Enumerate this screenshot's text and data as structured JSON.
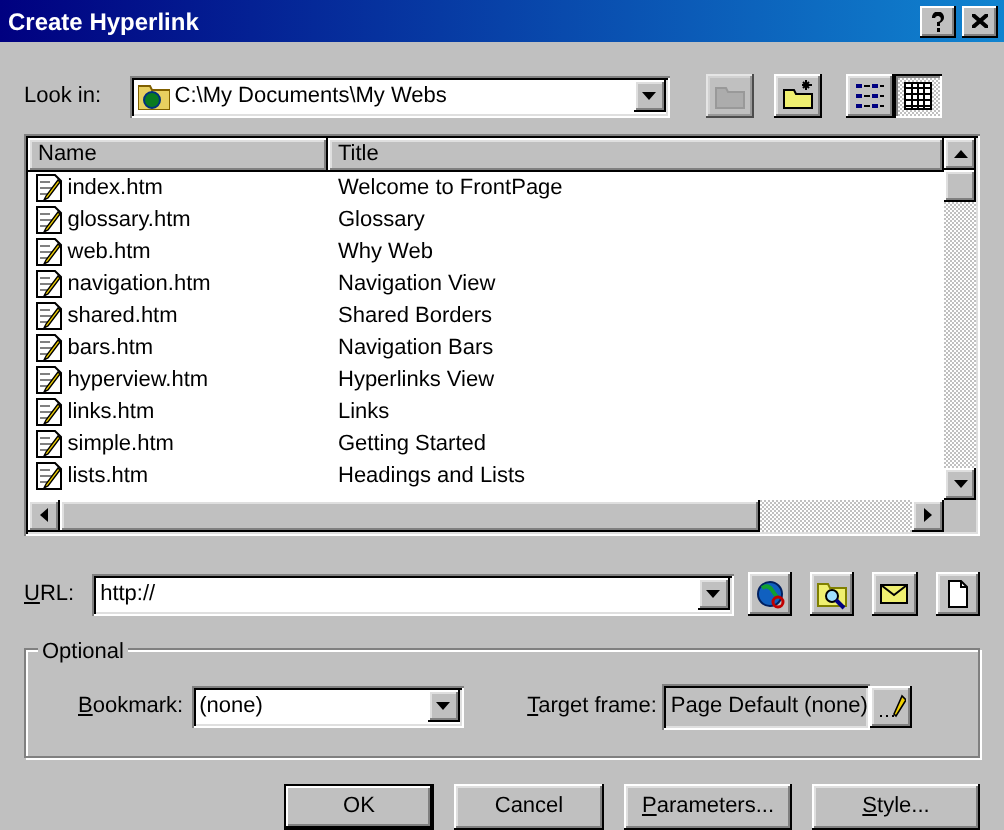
{
  "window": {
    "title": "Create Hyperlink"
  },
  "look_in": {
    "label": "Look in:",
    "value": "C:\\My Documents\\My Webs"
  },
  "toolbar": [
    {
      "kind": "up",
      "selected": false,
      "disabled": true
    },
    {
      "kind": "new-folder",
      "selected": false,
      "disabled": false
    },
    {
      "kind": "list",
      "selected": false,
      "disabled": false
    },
    {
      "kind": "details",
      "selected": true,
      "disabled": false
    }
  ],
  "file_list": {
    "columns": [
      "Name",
      "Title"
    ],
    "rows": [
      {
        "name": "index.htm",
        "title": "Welcome to FrontPage"
      },
      {
        "name": "glossary.htm",
        "title": "Glossary"
      },
      {
        "name": "web.htm",
        "title": "Why Web"
      },
      {
        "name": "navigation.htm",
        "title": "Navigation View"
      },
      {
        "name": "shared.htm",
        "title": "Shared Borders"
      },
      {
        "name": "bars.htm",
        "title": "Navigation Bars"
      },
      {
        "name": "hyperview.htm",
        "title": "Hyperlinks View"
      },
      {
        "name": "links.htm",
        "title": "Links"
      },
      {
        "name": "simple.htm",
        "title": "Getting Started"
      },
      {
        "name": "lists.htm",
        "title": "Headings and Lists"
      }
    ]
  },
  "url": {
    "label": "URL:",
    "underline_first": true,
    "value": "http://"
  },
  "url_buttons": [
    {
      "kind": "web"
    },
    {
      "kind": "file"
    },
    {
      "kind": "email"
    },
    {
      "kind": "new-page"
    }
  ],
  "optional": {
    "legend": "Optional",
    "bookmark": {
      "label": "Bookmark:",
      "underline_first": true,
      "value": "(none)"
    },
    "target_frame": {
      "label": "Target frame:",
      "underline_first": true,
      "value": "Page Default (none)"
    }
  },
  "buttons": [
    {
      "label": "OK",
      "underline_first": false,
      "default": true
    },
    {
      "label": "Cancel",
      "underline_first": false,
      "default": false
    },
    {
      "label": "Parameters...",
      "underline_first": true,
      "default": false
    },
    {
      "label": "Style...",
      "underline_first": true,
      "default": false
    }
  ]
}
